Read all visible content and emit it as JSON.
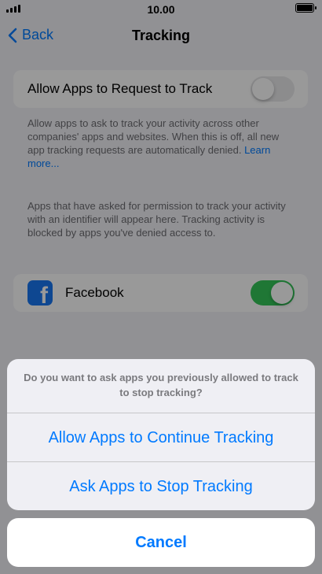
{
  "status": {
    "time": "10.00"
  },
  "nav": {
    "back_label": "Back",
    "title": "Tracking"
  },
  "allow_request": {
    "label": "Allow Apps to Request to Track",
    "enabled": false
  },
  "footnotes": {
    "first": "Allow apps to ask to track your activity across other companies' apps and websites. When this is off, all new app tracking requests are automatically denied.",
    "learn_more": "Learn more...",
    "second": "Apps that have asked for permission to track your activity with an identifier will appear here. Tracking activity is blocked by apps you've denied access to."
  },
  "apps": [
    {
      "name": "Facebook",
      "icon": "facebook-icon",
      "enabled": true
    }
  ],
  "action_sheet": {
    "message": "Do you want to ask apps you previously allowed to track to stop tracking?",
    "continue_label": "Allow Apps to Continue Tracking",
    "stop_label": "Ask Apps to Stop Tracking",
    "cancel_label": "Cancel"
  },
  "colors": {
    "accent": "#007aff",
    "switch_on": "#34c759",
    "facebook": "#1877f2"
  }
}
